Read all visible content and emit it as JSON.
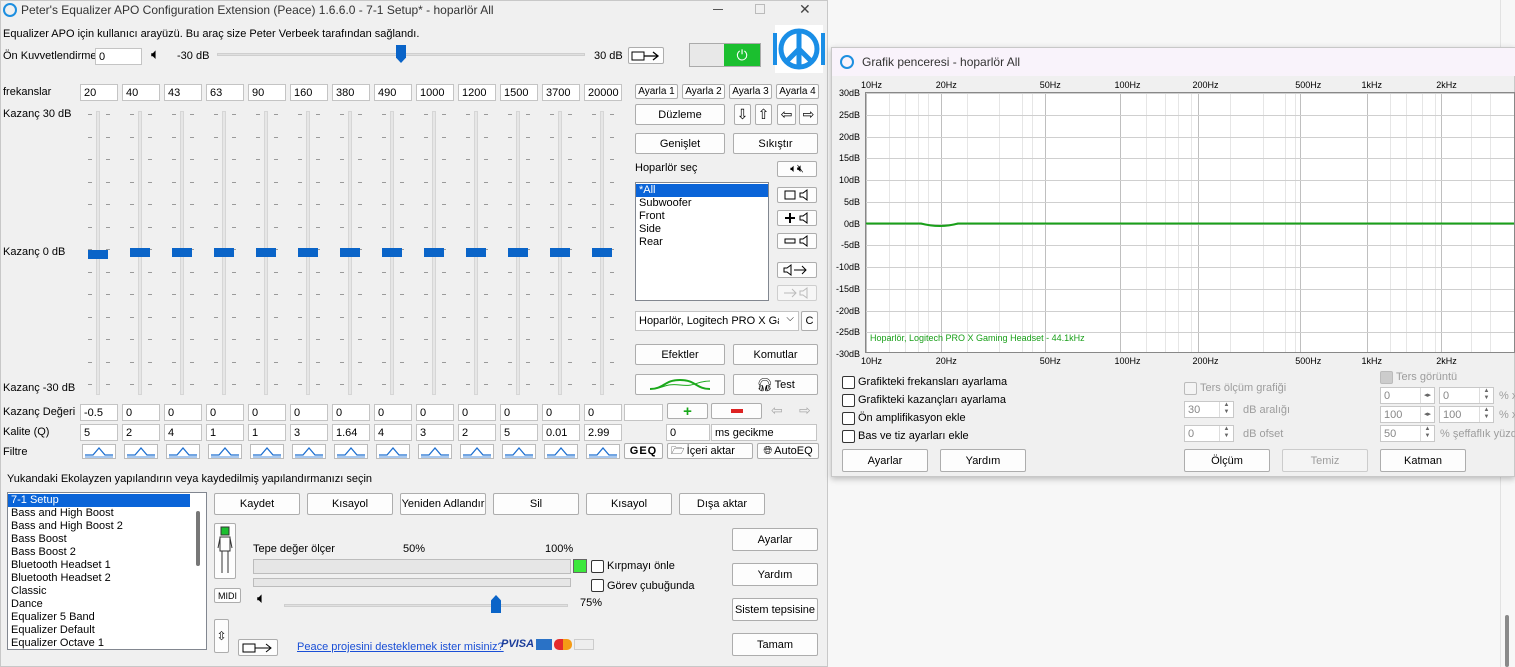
{
  "main": {
    "title": "Peter's Equalizer APO Configuration Extension (Peace) 1.6.6.0 - 7-1 Setup* - hoparlör All",
    "info": "Equalizer APO için kullanıcı arayüzü. Bu araç size Peter Verbeek tarafından sağlandı.",
    "preamp_label": "Ön Kuvvetlendirme",
    "preamp_value": "0",
    "preamp_min": "-30 dB",
    "preamp_max": "30 dB",
    "freq_label": "frekanslar",
    "frequencies": [
      "20",
      "40",
      "43",
      "63",
      "90",
      "160",
      "380",
      "490",
      "1000",
      "1200",
      "1500",
      "3700",
      "20000"
    ],
    "gain_top": "Kazanç 30 dB",
    "gain_mid": "Kazanç 0 dB",
    "gain_bot": "Kazanç -30 dB",
    "gain_values_label": "Kazanç Değeri",
    "gains": [
      "-0.5",
      "0",
      "0",
      "0",
      "0",
      "0",
      "0",
      "0",
      "0",
      "0",
      "0",
      "0",
      "0"
    ],
    "quality_label": "Kalite (Q)",
    "qualities": [
      "5",
      "2",
      "4",
      "1",
      "1",
      "3",
      "1.64",
      "4",
      "3",
      "2",
      "5",
      "0.01",
      "2.99"
    ],
    "filter_label": "Filtre",
    "delay_value": "0",
    "delay_label": "ms gecikme",
    "presets": [
      "Ayarla 1",
      "Ayarla 2",
      "Ayarla 3",
      "Ayarla 4"
    ],
    "btn_flatten": "Düzleme",
    "btn_expand": "Genişlet",
    "btn_compress": "Sıkıştır",
    "speaker_select_label": "Hoparlör seç",
    "speakers": [
      "*All",
      "Subwoofer",
      "Front",
      "Side",
      "Rear"
    ],
    "device": "Hoparlör, Logitech PRO X Gaming Headset",
    "device_btn": "C",
    "btn_effects": "Efektler",
    "btn_commands": "Komutlar",
    "btn_test": "Test",
    "btn_geq": "GEQ",
    "btn_import": "İçeri aktar",
    "btn_autoeq": "AutoEQ",
    "config_prompt": "Yukandaki Ekolayzen yapılandırın veya kaydedilmiş yapılandırmanızı seçin",
    "configs": [
      "7-1 Setup",
      "Bass and High Boost",
      "Bass and High Boost 2",
      "Bass Boost",
      "Bass Boost 2",
      "Bluetooth Headset 1",
      "Bluetooth Headset 2",
      "Classic",
      "Dance",
      "Equalizer 5 Band",
      "Equalizer Default",
      "Equalizer Octave 1"
    ],
    "btn_save": "Kaydet",
    "btn_shortcut": "Kısayol",
    "btn_rename": "Yeniden Adlandır",
    "btn_delete": "Sil",
    "btn_shortcut2": "Kısayol",
    "btn_export": "Dışa aktar",
    "peak_label": "Tepe değer ölçer",
    "peak_50": "50%",
    "peak_100": "100%",
    "clip_label": "Kırpmayı önle",
    "taskbar_label": "Görev çubuğunda",
    "volume_pct": "75%",
    "volume_level": 0.75,
    "midi": "MIDI",
    "btn_settings": "Ayarlar",
    "btn_help": "Yardım",
    "btn_tray": "Sistem tepsisine",
    "btn_ok": "Tamam",
    "support_link": "Peace projesini desteklemek ister misiniz?",
    "pay_logo": "PVISA",
    "accent_color": "#0a64c8",
    "power_color": "#1bbf2f"
  },
  "graph": {
    "title": "Grafik penceresi - hoparlör All",
    "x_ticks": [
      "10Hz",
      "20Hz",
      "50Hz",
      "100Hz",
      "200Hz",
      "500Hz",
      "1kHz",
      "2kHz"
    ],
    "y_ticks": [
      "30dB",
      "25dB",
      "20dB",
      "15dB",
      "10dB",
      "5dB",
      "0dB",
      "-5dB",
      "-10dB",
      "-15dB",
      "-20dB",
      "-25dB",
      "-30dB"
    ],
    "device_caption": "Hoparlör, Logitech PRO X Gaming Headset - 44.1kHz",
    "cb1": "Grafikteki frekansları ayarlama",
    "cb2": "Grafikteki kazançları ayarlama",
    "cb3": "Ön amplifikasyon ekle",
    "cb4": "Bas ve tiz ayarları ekle",
    "reverse_graph": "Ters ölçüm grafiği",
    "range_value": "30",
    "range_label": "dB aralığı",
    "offset_value": "0",
    "offset_label": "dB ofset",
    "reverse_view": "Ters görüntü",
    "sp1": "0",
    "sp2": "0",
    "sp3": "100",
    "sp4": "100",
    "sp5": "50",
    "pct_x1": "% x",
    "pct_x2": "% x",
    "transparency": "% şeffaflık yüzde",
    "btn_settings": "Ayarlar",
    "btn_help": "Yardım",
    "btn_measure": "Ölçüm",
    "btn_clear": "Temiz",
    "btn_layer": "Katman"
  }
}
